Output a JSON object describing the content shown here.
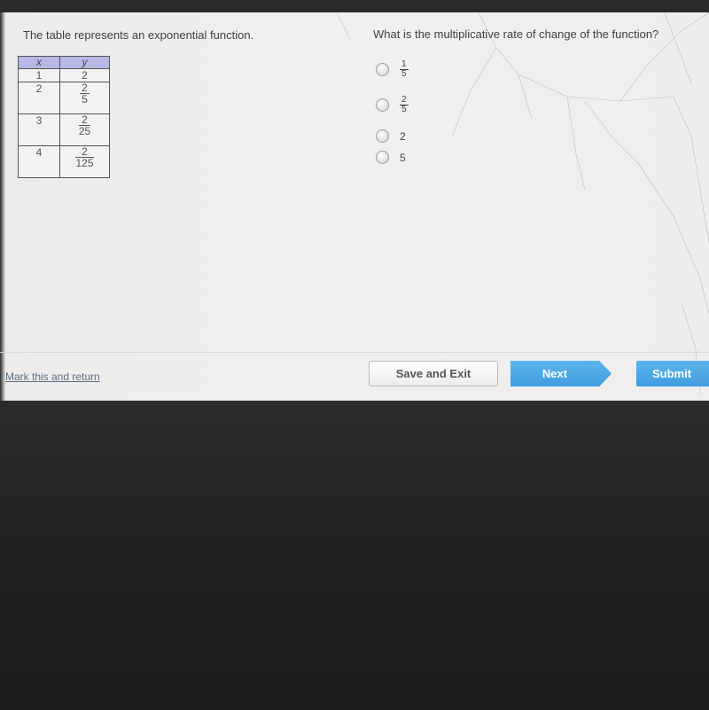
{
  "question": {
    "stem": "The table represents an exponential function.",
    "prompt": "What is the multiplicative rate of change of the function?"
  },
  "table": {
    "headers": [
      "x",
      "y"
    ],
    "rows": [
      {
        "x": "1",
        "y_num": "2",
        "y_den": ""
      },
      {
        "x": "2",
        "y_num": "2",
        "y_den": "5"
      },
      {
        "x": "3",
        "y_num": "2",
        "y_den": "25"
      },
      {
        "x": "4",
        "y_num": "2",
        "y_den": "125"
      }
    ]
  },
  "options": [
    {
      "num": "1",
      "den": "5"
    },
    {
      "num": "2",
      "den": "5"
    },
    {
      "text": "2"
    },
    {
      "text": "5"
    }
  ],
  "footer": {
    "mark_link": "Mark this and return",
    "save_exit": "Save and Exit",
    "next": "Next",
    "submit": "Submit"
  },
  "colors": {
    "accent": "#4aa8e6",
    "table_header": "#b7b8e6"
  }
}
